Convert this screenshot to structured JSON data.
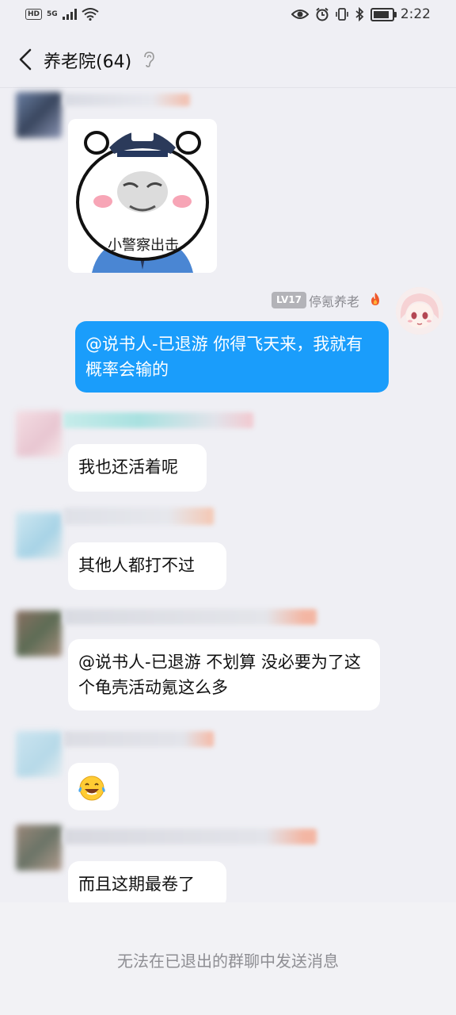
{
  "status_bar": {
    "network_label": "HD",
    "network_type": "5G",
    "time": "2:22",
    "battery_level": 0.85,
    "icons": [
      "hd-icon",
      "signal-icon",
      "wifi-icon",
      "eye-icon",
      "alarm-icon",
      "vibrate-icon",
      "bluetooth-icon",
      "battery-icon"
    ]
  },
  "header": {
    "title": "养老院(64)",
    "back_icon": "chevron-left-icon",
    "mute_icon": "ear-icon"
  },
  "self": {
    "level_badge": "LV17",
    "nickname": "停氪养老",
    "badge_icon": "flame-icon"
  },
  "messages": {
    "m1_sticker_caption": "小警察出击",
    "m2_text": "@说书人-已退游 你得飞天来，我就有概率会输的",
    "m3_text": "我也还活着呢",
    "m4_text": "其他人都打不过",
    "m5_text": "@说书人-已退游 不划算  没必要为了这个龟壳活动氪这么多",
    "m6_emoji": "😂",
    "m7_text": "而且这期最卷了"
  },
  "footer": {
    "notice": "无法在已退出的群聊中发送消息"
  },
  "colors": {
    "self_bubble": "#1a9dfb",
    "background": "#efeff4",
    "bubble": "#ffffff"
  }
}
